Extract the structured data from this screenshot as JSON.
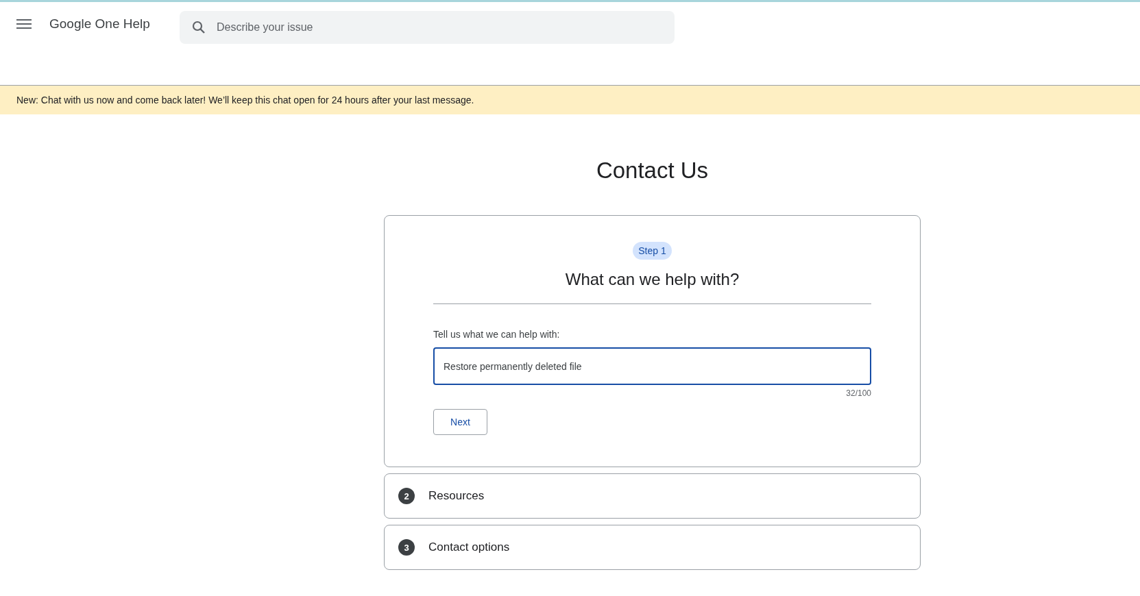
{
  "header": {
    "title": "Google One Help",
    "search": {
      "placeholder": "Describe your issue"
    }
  },
  "banner": {
    "text": "New: Chat with us now and come back later! We’ll keep this chat open for 24 hours after your last message."
  },
  "page_title": "Contact Us",
  "active_step": {
    "badge": "Step 1",
    "heading": "What can we help with?",
    "field_label": "Tell us what we can help with:",
    "value": "Restore permanently deleted file",
    "counter": "32/100",
    "button": "Next"
  },
  "steps": [
    {
      "number": "2",
      "title": "Resources"
    },
    {
      "number": "3",
      "title": "Contact options"
    }
  ]
}
